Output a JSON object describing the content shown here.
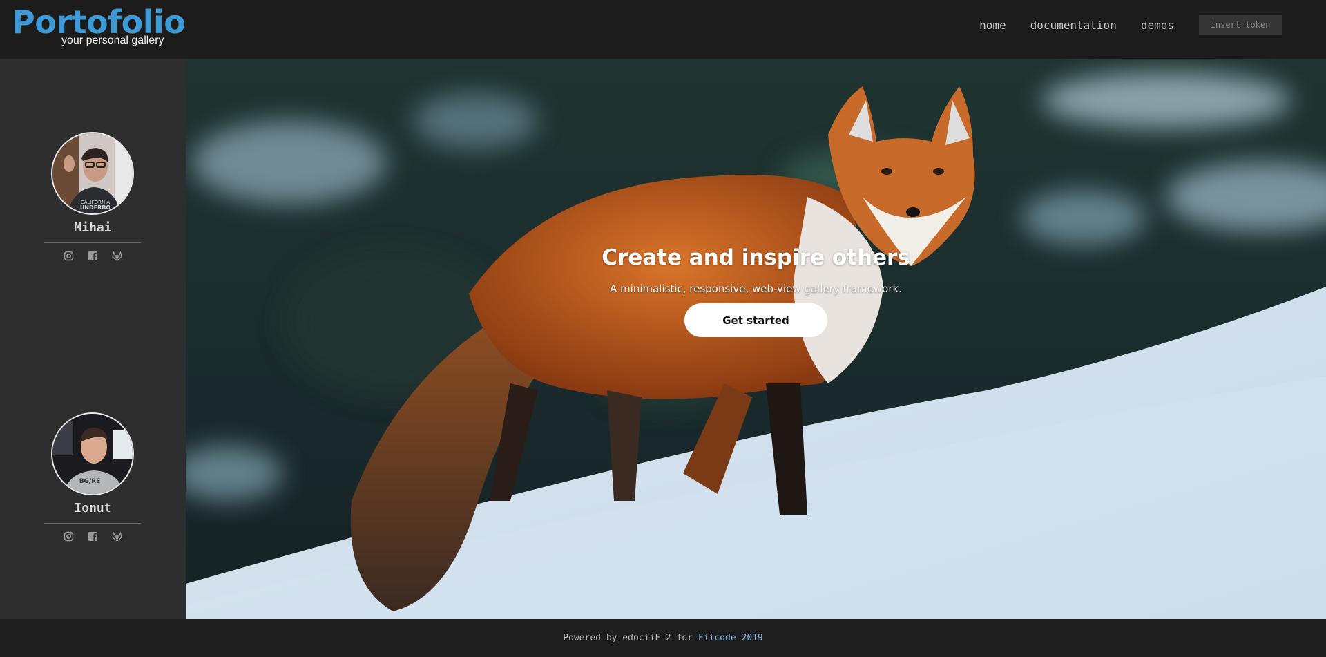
{
  "brand": {
    "title": "Portofolio",
    "subtitle": "your personal gallery",
    "accent_color": "#3d9ad6"
  },
  "nav": {
    "links": [
      "home",
      "documentation",
      "demos"
    ],
    "token_button": "insert token"
  },
  "sidebar": {
    "profiles": [
      {
        "name": "Mihai",
        "avatar_icon": "person-photo-icon",
        "social": [
          "instagram-icon",
          "facebook-icon",
          "gitlab-icon"
        ]
      },
      {
        "name": "Ionut",
        "avatar_icon": "person-photo-icon",
        "social": [
          "instagram-icon",
          "facebook-icon",
          "gitlab-icon"
        ]
      }
    ]
  },
  "hero": {
    "title": "Create and inspire others",
    "subtitle": "A minimalistic, responsive, web-view gallery framework.",
    "cta": "Get started",
    "background": "red fox standing in snow"
  },
  "footer": {
    "prefix": "Powered by edociiF 2 for",
    "link": "Fiicode 2019"
  }
}
